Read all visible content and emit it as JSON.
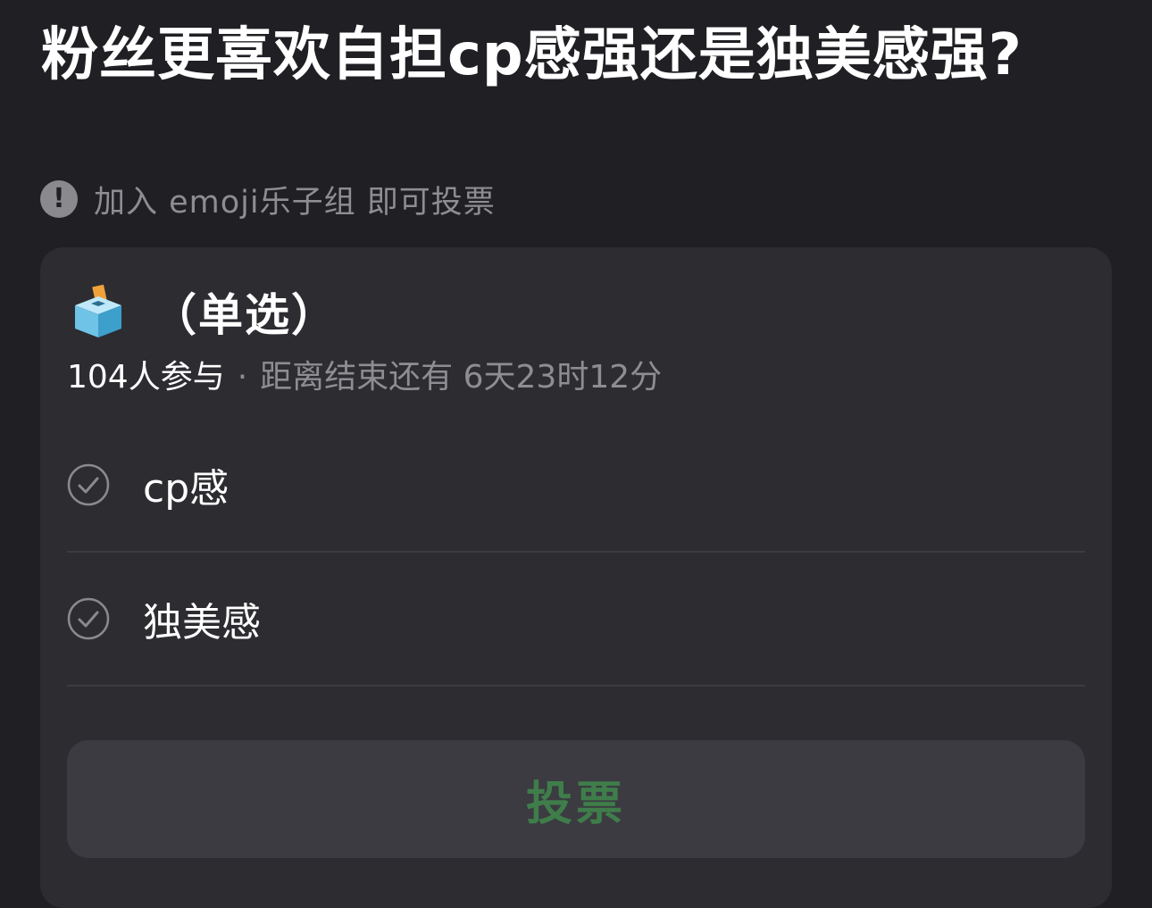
{
  "poll": {
    "title": "粉丝更喜欢自担cp感强还是独美感强?",
    "notice_text": "加入 emoji乐子组 即可投票",
    "type_label": "（单选）",
    "participants": "104人参与",
    "separator": "·",
    "time_left": "距离结束还有 6天23时12分",
    "options": [
      {
        "label": "cp感"
      },
      {
        "label": "独美感"
      }
    ],
    "vote_label": "投票"
  },
  "icons": {
    "notice": "exclamation-circle-icon",
    "type": "ballot-box-icon",
    "option": "check-circle-icon"
  },
  "colors": {
    "background": "#1f1f24",
    "card": "#2c2c31",
    "muted_text": "#8d8d92",
    "vote_text": "#3f7d4a"
  }
}
